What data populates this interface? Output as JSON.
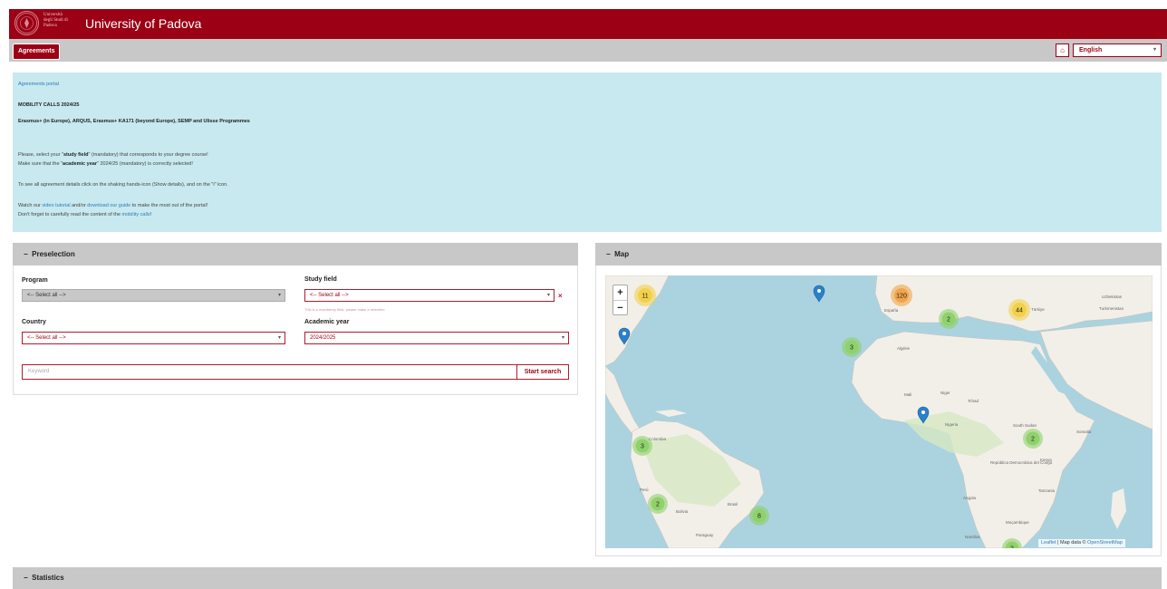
{
  "header": {
    "logo_text": "Università degli Studi di Padova",
    "title": "University of Padova"
  },
  "nav": {
    "agreements_label": "Agreements",
    "home_icon": "home-icon",
    "language": "English"
  },
  "info": {
    "portal_link": "Agreements portal",
    "calls_title": "MOBILITY CALLS 2024/25",
    "programmes": "Erasmus+ (in Europe), ARQUS, Erasmus+ KA171 (beyond Europe), SEMP and Ulisse Programmes",
    "line1_a": "Please, select your \"",
    "line1_b": "study field",
    "line1_c": "\" (mandatory) that corresponds to your degree course!",
    "line2_a": "Make sure that the \"",
    "line2_b": "academic year",
    "line2_c": "\" 2024/25 (mandatory) is correctly selected!",
    "line3": "To see all agreement details click on the shaking hands-icon (Show details), and on the \"i\" icon.",
    "line4_a": "Watch our ",
    "line4_b": "video tutorial",
    "line4_c": " and/or ",
    "line4_d": "download our guide",
    "line4_e": " to make the most out of the portal!",
    "line5_a": "Don't forget to carefully read the content of the ",
    "line5_b": "mobility calls",
    "line5_c": "!"
  },
  "preselection": {
    "title": "Preselection",
    "collapse": "−",
    "program_label": "Program",
    "program_value": "<-- Select all -->",
    "study_field_label": "Study field",
    "study_field_value": "<-- Select all -->",
    "study_field_error": "This is a mandatory field, please make a selection",
    "clear": "×",
    "country_label": "Country",
    "country_value": "<-- Select all -->",
    "year_label": "Academic year",
    "year_value": "2024/2025",
    "keyword_placeholder": "Keyword",
    "search_label": "Start search"
  },
  "map": {
    "title": "Map",
    "collapse": "−",
    "zoom_in": "+",
    "zoom_out": "−",
    "attribution_a": "Leaflet",
    "attribution_b": " | Map data © ",
    "attribution_c": "OpenStreetMap",
    "clusters": [
      "11",
      "120",
      "44",
      "2",
      "3",
      "3",
      "2",
      "2",
      "8",
      "2"
    ],
    "place_labels": [
      "España",
      "Algérie",
      "Mali",
      "Niger",
      "Tchad",
      "Nigeria",
      "South Sudan",
      "Kenya",
      "Tanzania",
      "Angola",
      "Namibia",
      "Moçambique",
      "Brasil",
      "Bolivia",
      "Perú",
      "Colombia",
      "Paraguay",
      "Türkiye",
      "Uzbekistan",
      "Turkmenistan",
      "Somalia",
      "República Democrática del Congo"
    ]
  },
  "statistics": {
    "title": "Statistics",
    "collapse": "−"
  },
  "colors": {
    "brand": "#9b0014",
    "info_bg": "#c7e9ef",
    "panel_header": "#c8c8c8",
    "water": "#abd3df",
    "land": "#f2efe9",
    "cluster_green": "#8fd16b",
    "cluster_yellow": "#f2d14a",
    "cluster_orange": "#f0a54a",
    "marker_blue": "#2a81cb"
  }
}
